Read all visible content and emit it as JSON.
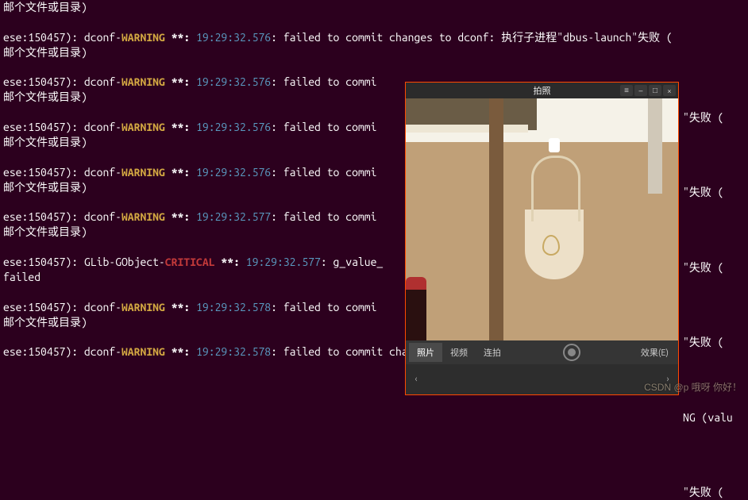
{
  "terminal": {
    "lines": [
      {
        "parts": [
          {
            "t": "邮个文件或目录)",
            "c": "c-white"
          }
        ]
      },
      {
        "parts": []
      },
      {
        "parts": [
          {
            "t": "ese:150457): dconf-",
            "c": "c-white"
          },
          {
            "t": "WARNING",
            "c": "c-warn"
          },
          {
            "t": " **: ",
            "c": "c-white c-bold"
          },
          {
            "t": "19:29:32.576",
            "c": "c-time"
          },
          {
            "t": ": failed to commit changes to dconf: 执行子进程\"dbus-launch\"失败 (",
            "c": "c-white"
          }
        ]
      },
      {
        "parts": [
          {
            "t": "邮个文件或目录)",
            "c": "c-white"
          }
        ]
      },
      {
        "parts": []
      },
      {
        "parts": [
          {
            "t": "ese:150457): dconf-",
            "c": "c-white"
          },
          {
            "t": "WARNING",
            "c": "c-warn"
          },
          {
            "t": " **: ",
            "c": "c-white c-bold"
          },
          {
            "t": "19:29:32.576",
            "c": "c-time"
          },
          {
            "t": ": failed to commi",
            "c": "c-white"
          }
        ]
      },
      {
        "parts": [
          {
            "t": "邮个文件或目录)",
            "c": "c-white"
          }
        ]
      },
      {
        "parts": []
      },
      {
        "parts": [
          {
            "t": "ese:150457): dconf-",
            "c": "c-white"
          },
          {
            "t": "WARNING",
            "c": "c-warn"
          },
          {
            "t": " **: ",
            "c": "c-white c-bold"
          },
          {
            "t": "19:29:32.576",
            "c": "c-time"
          },
          {
            "t": ": failed to commi",
            "c": "c-white"
          }
        ]
      },
      {
        "parts": [
          {
            "t": "邮个文件或目录)",
            "c": "c-white"
          }
        ]
      },
      {
        "parts": []
      },
      {
        "parts": [
          {
            "t": "ese:150457): dconf-",
            "c": "c-white"
          },
          {
            "t": "WARNING",
            "c": "c-warn"
          },
          {
            "t": " **: ",
            "c": "c-white c-bold"
          },
          {
            "t": "19:29:32.576",
            "c": "c-time"
          },
          {
            "t": ": failed to commi",
            "c": "c-white"
          }
        ]
      },
      {
        "parts": [
          {
            "t": "邮个文件或目录)",
            "c": "c-white"
          }
        ]
      },
      {
        "parts": []
      },
      {
        "parts": [
          {
            "t": "ese:150457): dconf-",
            "c": "c-white"
          },
          {
            "t": "WARNING",
            "c": "c-warn"
          },
          {
            "t": " **: ",
            "c": "c-white c-bold"
          },
          {
            "t": "19:29:32.577",
            "c": "c-time"
          },
          {
            "t": ": failed to commi",
            "c": "c-white"
          }
        ]
      },
      {
        "parts": [
          {
            "t": "邮个文件或目录)",
            "c": "c-white"
          }
        ]
      },
      {
        "parts": []
      },
      {
        "parts": [
          {
            "t": "ese:150457): GLib-GObject-",
            "c": "c-white"
          },
          {
            "t": "CRITICAL",
            "c": "c-crit"
          },
          {
            "t": " **: ",
            "c": "c-white c-bold"
          },
          {
            "t": "19:29:32.577",
            "c": "c-time"
          },
          {
            "t": ": g_value_",
            "c": "c-white"
          }
        ]
      },
      {
        "parts": [
          {
            "t": "failed",
            "c": "c-white"
          }
        ]
      },
      {
        "parts": []
      },
      {
        "parts": [
          {
            "t": "ese:150457): dconf-",
            "c": "c-white"
          },
          {
            "t": "WARNING",
            "c": "c-warn"
          },
          {
            "t": " **: ",
            "c": "c-white c-bold"
          },
          {
            "t": "19:29:32.578",
            "c": "c-time"
          },
          {
            "t": ": failed to commi",
            "c": "c-white"
          }
        ]
      },
      {
        "parts": [
          {
            "t": "邮个文件或目录)",
            "c": "c-white"
          }
        ]
      },
      {
        "parts": []
      },
      {
        "parts": [
          {
            "t": "ese:150457): dconf-",
            "c": "c-white"
          },
          {
            "t": "WARNING",
            "c": "c-warn"
          },
          {
            "t": " **: ",
            "c": "c-white c-bold"
          },
          {
            "t": "19:29:32.578",
            "c": "c-time"
          },
          {
            "t": ": failed to commit changes to dconf. 执行子进程\"dbus-launch\"失败 (",
            "c": "c-white"
          }
        ]
      }
    ],
    "right_tail_fail": "\"失败 (",
    "right_tail_ing": "NG (valu"
  },
  "app": {
    "title": "拍照",
    "menu_icon": "≡",
    "min_icon": "–",
    "max_icon": "□",
    "close_icon": "×",
    "tabs": {
      "photo": "照片",
      "video": "视频",
      "burst": "连拍"
    },
    "effects_label": "效果(E)",
    "nav_prev": "‹",
    "nav_next": "›"
  },
  "watermark": "CSDN @p 哦呀  你好！"
}
